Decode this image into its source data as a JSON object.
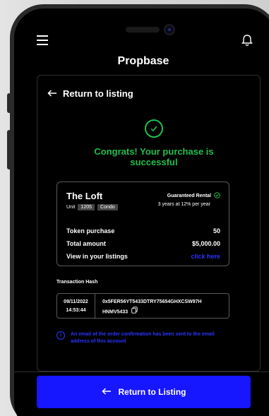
{
  "app": {
    "title": "Propbase"
  },
  "icons": {
    "menu": "hamburger-icon",
    "notifications": "bell-icon",
    "success": "check-circle-icon",
    "back": "arrow-left-icon",
    "copy": "copy-icon",
    "info": "info-icon"
  },
  "back_link": {
    "label": "Return to listing"
  },
  "success_message": {
    "line1": "Congrats! Your purchase is",
    "line2": "successful"
  },
  "property": {
    "name": "The Loft",
    "unit_label": "Unit",
    "unit_number": "1205",
    "type": "Condo",
    "badge": "Guaranteed Rental",
    "badge_detail": "3 years at 12% per year"
  },
  "summary": {
    "token_purchase": {
      "label": "Token purchase",
      "value": "50"
    },
    "total_amount": {
      "label": "Total amount",
      "value": "$5,000.00"
    },
    "view_listings": {
      "label": "View in your listings",
      "link": "click here"
    }
  },
  "transaction": {
    "label": "Transaction Hash",
    "date": "09/11/2022",
    "time": "14:53:44",
    "hash_line1": "0x5FER56YT5433DTRY75654GHXCSW97H",
    "hash_line2": "HNMV5433"
  },
  "notice": {
    "text": "An email of the order confirmation has been sent to the email address of this account"
  },
  "cta": {
    "label": "Return to Listing"
  },
  "colors": {
    "accent": "#1616ff",
    "success": "#1fbf4e",
    "link": "#2b34ff",
    "background": "#000000"
  }
}
